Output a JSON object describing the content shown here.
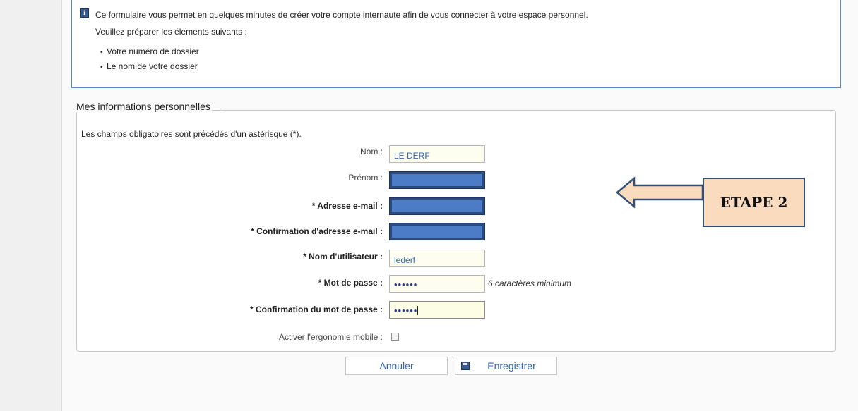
{
  "info": {
    "icon": "info-icon",
    "intro": "Ce formulaire vous permet en quelques minutes de créer votre compte internaute afin de vous connecter à votre espace personnel.",
    "prepare": "Veuillez préparer les élements suivants :",
    "items": [
      "Votre numéro de dossier",
      "Le nom de votre dossier"
    ]
  },
  "section": {
    "legend": "Mes informations personnelles",
    "required_note": "Les champs obligatoires sont précédés d'un astérisque (*)."
  },
  "fields": {
    "nom": {
      "label": "Nom :",
      "value": "LE DERF"
    },
    "prenom": {
      "label": "Prénom :"
    },
    "email": {
      "label": "* Adresse e-mail :"
    },
    "email_confirm": {
      "label": "* Confirmation d'adresse e-mail :"
    },
    "username": {
      "label": "* Nom d'utilisateur :",
      "value": "lederf"
    },
    "password": {
      "label": "* Mot de passe :",
      "value": "••••••",
      "hint": "6 caractères minimum"
    },
    "password_confirm": {
      "label": "* Confirmation du mot de passe :",
      "value": "••••••"
    },
    "mobile": {
      "label": "Activer l'ergonomie mobile :",
      "checked": false
    }
  },
  "buttons": {
    "cancel": "Annuler",
    "save": "Enregistrer",
    "save_icon": "floppy-disk-icon"
  },
  "annotation": {
    "label": "ETAPE 2",
    "arrow_icon": "left-arrow-icon",
    "fill_color": "#fbdbbe",
    "border_color": "#2f4e7a"
  },
  "colors": {
    "accent_border": "#5a87c5",
    "link_text": "#3465b5",
    "masked_fill": "#4d7cc7"
  }
}
